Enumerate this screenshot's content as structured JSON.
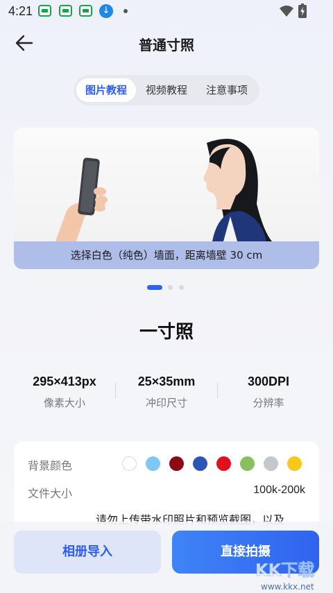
{
  "status_bar": {
    "time": "4:21"
  },
  "header": {
    "title": "普通寸照"
  },
  "tabs": [
    {
      "label": "图片教程",
      "active": true
    },
    {
      "label": "视频教程",
      "active": false
    },
    {
      "label": "注意事项",
      "active": false
    }
  ],
  "banner": {
    "caption": "选择白色（纯色）墙面，距离墙壁 30 cm",
    "page_index": 1,
    "page_count": 3
  },
  "photo": {
    "name": "一寸照",
    "specs": [
      {
        "value": "295×413px",
        "label": "像素大小"
      },
      {
        "value": "25×35mm",
        "label": "冲印尺寸"
      },
      {
        "value": "300DPI",
        "label": "分辨率"
      }
    ]
  },
  "settings": {
    "background_label": "背景颜色",
    "background_colors": [
      "#ffffff",
      "#7ec8f2",
      "#8b0a14",
      "#2c55b8",
      "#e0101c",
      "#88c060",
      "#c2c8cc",
      "#f8c81a"
    ],
    "filesize_label": "文件大小",
    "filesize_value": "100k-200k",
    "notice": "请勿上传带水印照片和预览截图，以及"
  },
  "buttons": {
    "album": "相册导入",
    "shoot": "直接拍摄"
  },
  "watermark": {
    "brand": "KK下载",
    "url": "www.kkx.net"
  }
}
